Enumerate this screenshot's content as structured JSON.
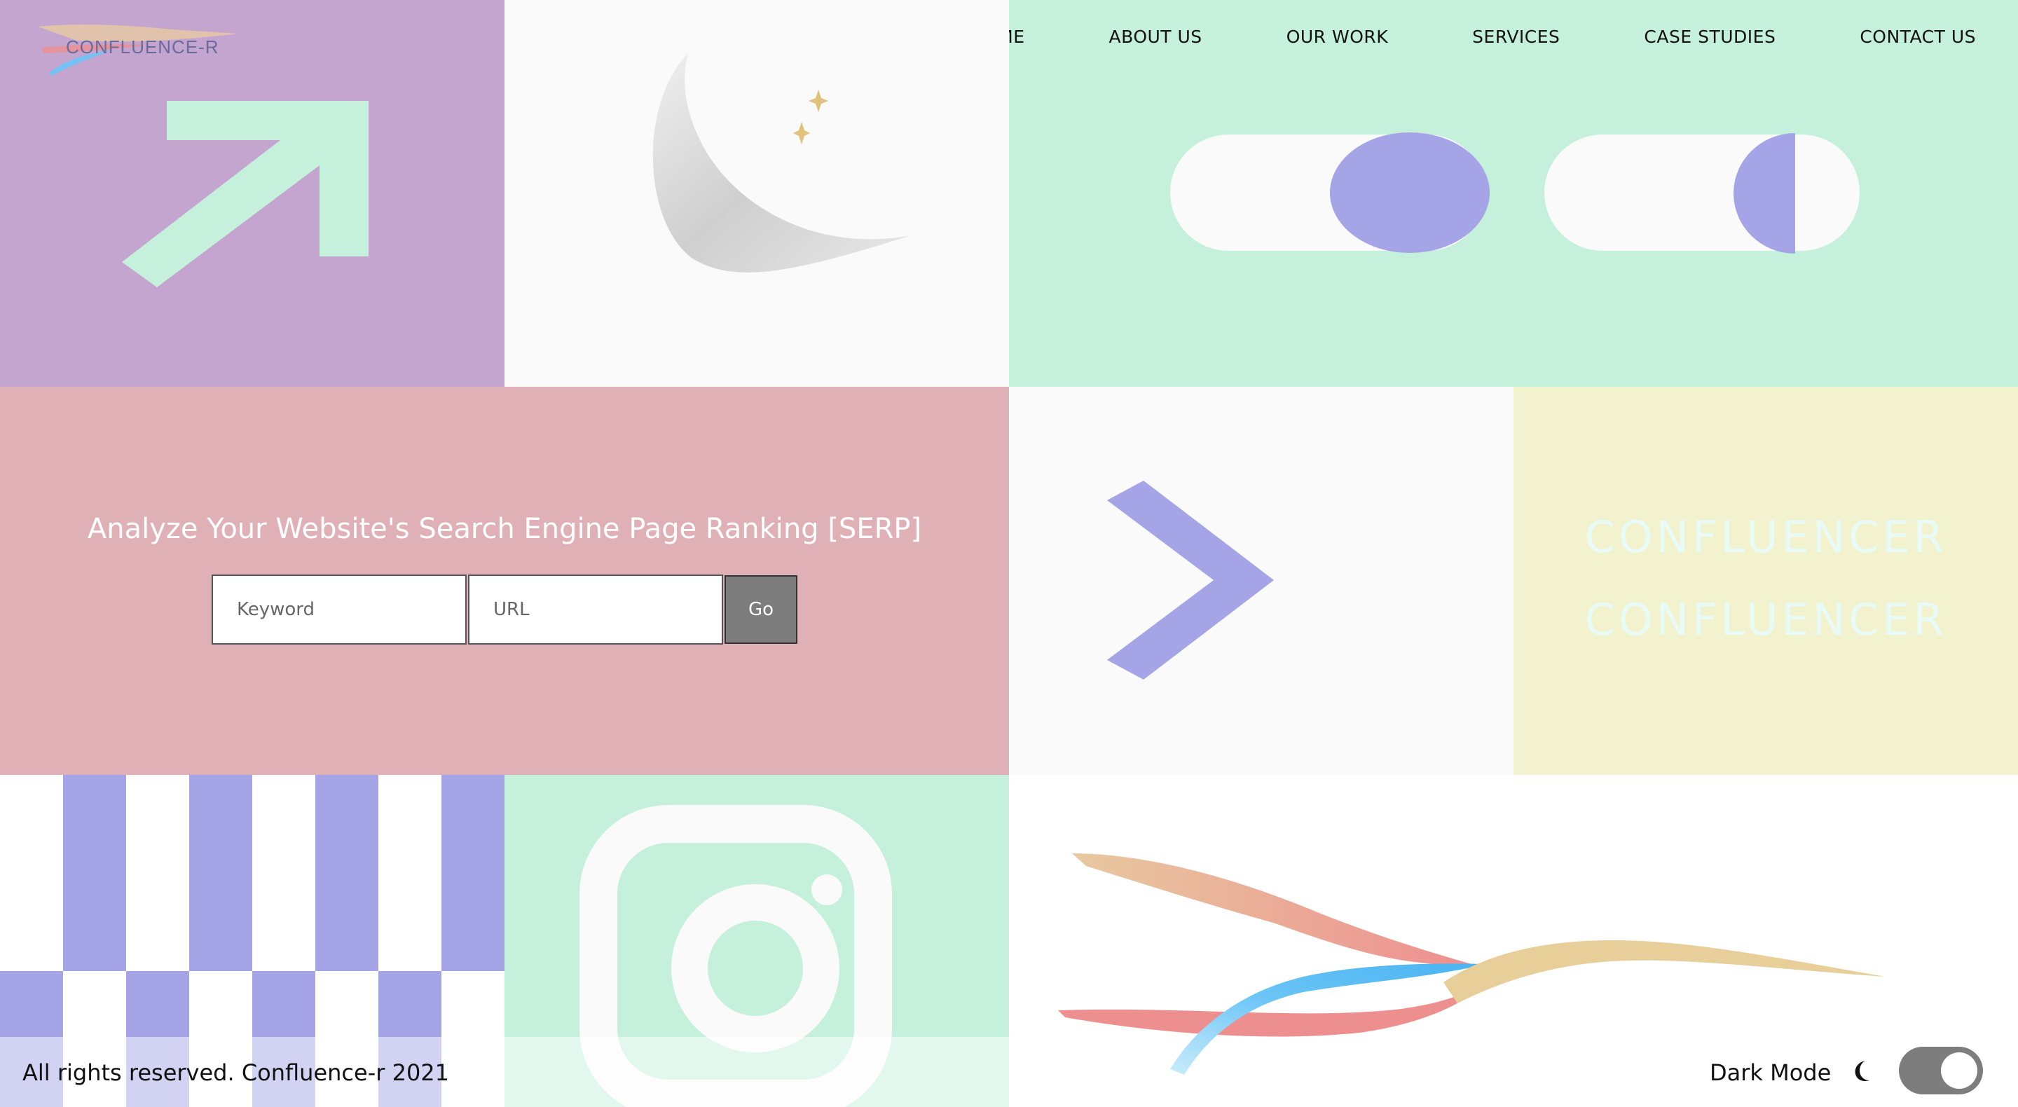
{
  "logo": {
    "text": "CONFLUENCE-R"
  },
  "nav": {
    "items": [
      "HOME",
      "ABOUT US",
      "OUR WORK",
      "SERVICES",
      "CASE STUDIES",
      "CONTACT US"
    ]
  },
  "serp": {
    "title": "Analyze Your Website's Search Engine Page Ranking [SERP]",
    "keyword_placeholder": "Keyword",
    "url_placeholder": "URL",
    "go_label": "Go"
  },
  "wordmark": {
    "line1": "CONFLUENCER",
    "line2": "CONFLUENCER"
  },
  "footer": {
    "copyright": "All rights reserved. Confluence-r 2021",
    "dark_mode_label": "Dark Mode",
    "dark_mode_on": true
  },
  "icons": {
    "moon": "moon-icon",
    "instagram": "instagram-icon",
    "arrow": "arrow-up-right-icon",
    "chevron": "chevron-right-icon"
  },
  "colors": {
    "purple": "#c4a5d0",
    "mint": "#c5f0dc",
    "pink": "#dfb0b6",
    "periwinkle": "#a4a4e6",
    "cream": "#f2f2ce"
  }
}
